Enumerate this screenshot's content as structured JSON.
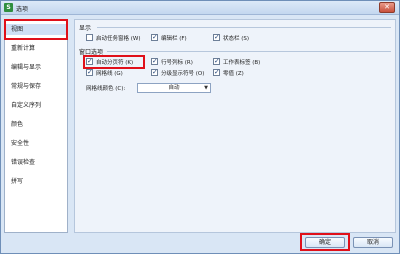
{
  "window": {
    "title": "选项",
    "app_icon_glyph": "S"
  },
  "sidebar": {
    "items": [
      {
        "label": "视图"
      },
      {
        "label": "重新计算"
      },
      {
        "label": "编辑与显示"
      },
      {
        "label": "常规与保存"
      },
      {
        "label": "自定义序列"
      },
      {
        "label": "颜色"
      },
      {
        "label": "安全性"
      },
      {
        "label": "错误检查"
      },
      {
        "label": "拼写"
      }
    ],
    "selected_index": 0
  },
  "display": {
    "label": "显示",
    "options": [
      {
        "label": "启动任务窗格 (W)",
        "checked": false
      },
      {
        "label": "编辑栏 (F)",
        "checked": true
      },
      {
        "label": "状态栏 (S)",
        "checked": true
      }
    ]
  },
  "window_options": {
    "label": "窗口选项",
    "options": [
      {
        "label": "自动分页符 (K)",
        "checked": true
      },
      {
        "label": "行号列标 (R)",
        "checked": true
      },
      {
        "label": "工作表标签 (B)",
        "checked": true
      },
      {
        "label": "网格线 (G)",
        "checked": true
      },
      {
        "label": "分级显示符号 (O)",
        "checked": true
      },
      {
        "label": "零值 (Z)",
        "checked": true
      }
    ],
    "gridline_color_label": "网格线颜色 (C):",
    "gridline_color_value": "自动"
  },
  "buttons": {
    "ok": "确定",
    "cancel": "取消"
  },
  "colors": {
    "highlight_red": "#e0101a",
    "accent_blue": "#cfe0f5"
  },
  "icons": {
    "dropdown": "chevron-down-icon",
    "close": "close-icon"
  }
}
